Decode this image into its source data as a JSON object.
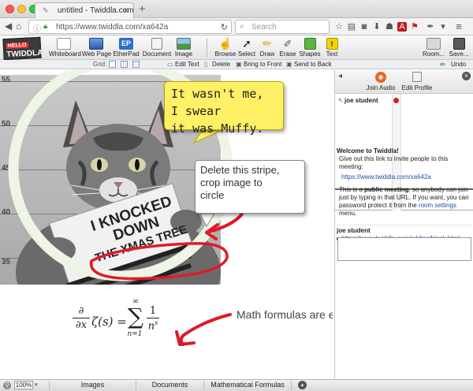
{
  "browser": {
    "tab_title": "untitled - Twiddla.com",
    "url": "https://www.twiddla.com/xa642a",
    "search_placeholder": "Search"
  },
  "toolbar": {
    "logo_line1": "HELLO",
    "logo_line2": "TWIDDLA",
    "tools": [
      {
        "label": "Whiteboard",
        "icon": "whiteboard-icon"
      },
      {
        "label": "Web Page",
        "icon": "webpage-icon"
      },
      {
        "label": "EtherPad",
        "icon": "etherpad-icon",
        "badge": "EP"
      },
      {
        "label": "Document",
        "icon": "document-icon"
      },
      {
        "label": "Image",
        "icon": "image-icon"
      },
      {
        "label": "Browse",
        "icon": "hand-icon"
      },
      {
        "label": "Select",
        "icon": "pointer-icon"
      },
      {
        "label": "Draw",
        "icon": "pencil-icon"
      },
      {
        "label": "Erase",
        "icon": "eraser-icon"
      },
      {
        "label": "Shapes",
        "icon": "shapes-icon"
      },
      {
        "label": "Text",
        "icon": "text-icon"
      },
      {
        "label": "Room...",
        "icon": "room-icon"
      },
      {
        "label": "Save...",
        "icon": "save-icon"
      }
    ]
  },
  "toolbar2": {
    "grid_label": "Grid:",
    "edit_text": "Edit Text",
    "delete": "Delete",
    "bring_to_front": "Bring to Front",
    "send_to_back": "Send to Back",
    "undo": "Undo"
  },
  "canvas": {
    "ruler_marks": [
      "55",
      "50",
      "45",
      "40",
      "35"
    ],
    "sign_text": [
      "I KNOCKED",
      "DOWN",
      "THE XMAS TREE"
    ],
    "callout1": [
      "It wasn't me, I swear",
      "it was Muffy."
    ],
    "callout2": [
      "Delete this stripe,",
      "crop image to",
      "circle"
    ],
    "note3": "Math formulas are easy to add",
    "formula": {
      "d": "∂",
      "dx": "∂x",
      "zeta": "ζ(s) =",
      "sum": "∑",
      "upper": "∞",
      "lower": "n=1",
      "one": "1",
      "ns": "n"
    }
  },
  "panel": {
    "join_audio": "Join Audio",
    "edit_profile": "Edit Profile",
    "user": "joe student",
    "welcome_title": "Welcome to Twiddla!",
    "invite_text": "Give out this link to invite people to this meeting:",
    "invite_link": "https://www.twiddla.com/xa642a",
    "public_text_1": "This is a ",
    "public_bold": "public meeting",
    "public_text_2": ", so anybody can join just by typing in that URL. If you want, you can password protect it from the ",
    "room_settings": "room settings",
    "public_text_3": " menu.",
    "chat_user": "joe student",
    "chat_link": "https://www.twiddla.com/addins/blank.html"
  },
  "bottom": {
    "zoom": "100%",
    "tabs": [
      "Images",
      "Documents",
      "Mathematical Formulas"
    ]
  },
  "colors": {
    "callout_yellow": "#fff066",
    "arrow_red": "#e0192b",
    "link_blue": "#1a4fa8"
  }
}
